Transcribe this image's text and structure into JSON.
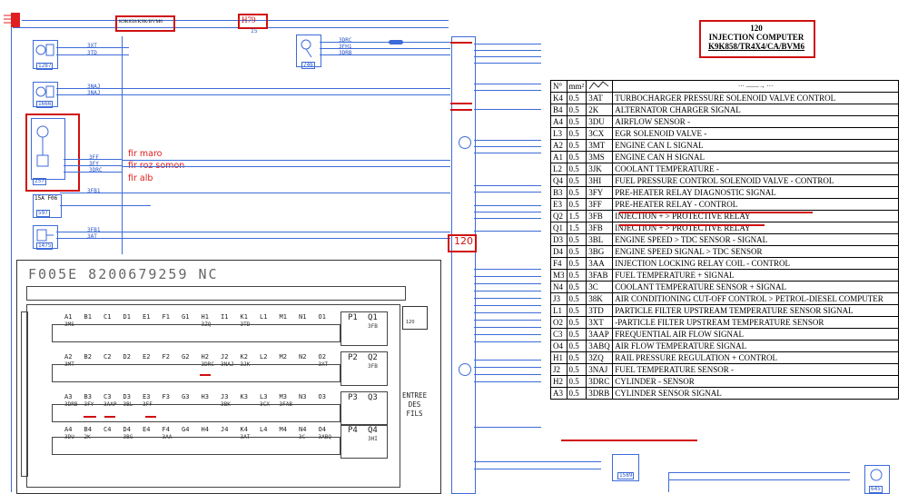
{
  "header": {
    "connector_code": "K9K858/K9K/BVM6",
    "h_code": "H79",
    "h_sub": "15"
  },
  "component": {
    "number": "120",
    "name": "INJECTION COMPUTER",
    "variant": "K9K858/TR4X4/CA/BVM6",
    "ecu_label": "120"
  },
  "annotations": {
    "fir_maro": "fir maro",
    "fir_roz": "fir roz somon",
    "fir_alb": "fir alb"
  },
  "left_components": [
    {
      "id": "1287",
      "wires": [
        "3XT",
        "3TD"
      ]
    },
    {
      "id": "1666",
      "wires": [
        "3NAJ",
        "3NAJ"
      ]
    },
    {
      "id": "257",
      "wires": [
        "3FF",
        "3FY",
        "3DRC"
      ]
    },
    {
      "id": "597",
      "wires": [
        "3FB1"
      ]
    },
    {
      "id": "1475",
      "wires": [
        "3FB1",
        "3AT"
      ]
    }
  ],
  "mid_component": {
    "id": "746",
    "wires": [
      "3DRC",
      "3FH1",
      "3DRB"
    ]
  },
  "bottom_component": {
    "id": "1589"
  },
  "right_component": {
    "id": "645"
  },
  "fuse_label": "15A F06",
  "connector_panel": {
    "ref": "F005E  8200679259  NC",
    "side_label_lines": [
      "ENTREE",
      "DES",
      "FILS"
    ],
    "icon_label": "120",
    "rows": [
      {
        "cells": [
          "A1",
          "B1",
          "C1",
          "D1",
          "E1",
          "F1",
          "G1",
          "H1",
          "I1",
          "K1",
          "L1",
          "M1",
          "N1",
          "O1"
        ],
        "codes": [
          "3MS",
          "",
          "",
          "",
          "",
          "",
          "",
          "3ZQ",
          "",
          "3TD",
          "",
          "",
          "",
          ""
        ]
      },
      {
        "cells": [
          "A2",
          "B2",
          "C2",
          "D2",
          "E2",
          "F2",
          "G2",
          "H2",
          "J2",
          "K2",
          "L2",
          "M2",
          "N2",
          "O2"
        ],
        "codes": [
          "3MT",
          "",
          "",
          "",
          "",
          "",
          "",
          "3DRC",
          "3NAJ",
          "3JK",
          "",
          "",
          "",
          "3XT"
        ]
      },
      {
        "cells": [
          "A3",
          "B3",
          "C3",
          "D3",
          "E3",
          "F3",
          "G3",
          "H3",
          "J3",
          "K3",
          "L3",
          "M3",
          "N3",
          "O3"
        ],
        "codes": [
          "3DRB",
          "3FY",
          "3AAP",
          "3BL",
          "3FF",
          "",
          "",
          "",
          "3BK",
          "",
          "3CX",
          "3FAB",
          "",
          ""
        ]
      },
      {
        "cells": [
          "A4",
          "B4",
          "C4",
          "D4",
          "E4",
          "F4",
          "G4",
          "H4",
          "J4",
          "K4",
          "L4",
          "M4",
          "N4",
          "O4"
        ],
        "codes": [
          "3DU",
          "2K",
          "",
          "3BG",
          "",
          "3AA",
          "",
          "",
          "",
          "3AT",
          "",
          "",
          "3C",
          "3ABQ"
        ]
      }
    ],
    "p_rows": [
      {
        "labels": [
          "P1",
          "Q1"
        ],
        "code": "3FB"
      },
      {
        "labels": [
          "P2",
          "Q2"
        ],
        "code": "3FB"
      },
      {
        "labels": [
          "P3",
          "Q3"
        ],
        "code": ""
      },
      {
        "labels": [
          "P4",
          "Q4"
        ],
        "code": "3HI"
      }
    ]
  },
  "table": {
    "headers": [
      "N°",
      "mm²",
      "",
      ""
    ],
    "arrow_header": "··· ——→ ···",
    "rows": [
      {
        "pin": "K4",
        "mm": "0.5",
        "code": "3AT",
        "desc": "TURBOCHARGER PRESSURE SOLENOID VALVE CONTROL"
      },
      {
        "pin": "B4",
        "mm": "0.5",
        "code": "2K",
        "desc": "ALTERNATOR CHARGER SIGNAL"
      },
      {
        "pin": "A4",
        "mm": "0.5",
        "code": "3DU",
        "desc": "AIRFLOW SENSOR -"
      },
      {
        "pin": "L3",
        "mm": "0.5",
        "code": "3CX",
        "desc": "EGR SOLENOID VALVE -"
      },
      {
        "pin": "A2",
        "mm": "0.5",
        "code": "3MT",
        "desc": "ENGINE CAN L SIGNAL"
      },
      {
        "pin": "A1",
        "mm": "0.5",
        "code": "3MS",
        "desc": "ENGINE CAN H SIGNAL"
      },
      {
        "pin": "L2",
        "mm": "0.5",
        "code": "3JK",
        "desc": "COOLANT TEMPERATURE -"
      },
      {
        "pin": "Q4",
        "mm": "0.5",
        "code": "3HI",
        "desc": "FUEL PRESSURE CONTROL SOLENOID VALVE - CONTROL"
      },
      {
        "pin": "B3",
        "mm": "0.5",
        "code": "3FY",
        "desc": "PRE-HEATER RELAY DIAGNOSTIC SIGNAL"
      },
      {
        "pin": "E3",
        "mm": "0.5",
        "code": "3FF",
        "desc": "PRE-HEATER RELAY - CONTROL"
      },
      {
        "pin": "Q2",
        "mm": "1.5",
        "code": "3FB",
        "desc": "INJECTION + > PROTECTIVE RELAY"
      },
      {
        "pin": "Q1",
        "mm": "1.5",
        "code": "3FB",
        "desc": "INJECTION + > PROTECTIVE RELAY"
      },
      {
        "pin": "D3",
        "mm": "0.5",
        "code": "3BL",
        "desc": "ENGINE SPEED > TDC SENSOR - SIGNAL"
      },
      {
        "pin": "D4",
        "mm": "0.5",
        "code": "3BG",
        "desc": "ENGINE SPEED SIGNAL > TDC SENSOR"
      },
      {
        "pin": "F4",
        "mm": "0.5",
        "code": "3AA",
        "desc": "INJECTION LOCKING RELAY COIL - CONTROL"
      },
      {
        "pin": "M3",
        "mm": "0.5",
        "code": "3FAB",
        "desc": "FUEL TEMPERATURE + SIGNAL"
      },
      {
        "pin": "N4",
        "mm": "0.5",
        "code": "3C",
        "desc": "COOLANT TEMPERATURE SENSOR + SIGNAL"
      },
      {
        "pin": "J3",
        "mm": "0.5",
        "code": "38K",
        "desc": "AIR CONDITIONING CUT-OFF CONTROL > PETROL-DIESEL COMPUTER"
      },
      {
        "pin": "L1",
        "mm": "0.5",
        "code": "3TD",
        "desc": "PARTICLE FILTER UPSTREAM TEMPERATURE SENSOR SIGNAL"
      },
      {
        "pin": "O2",
        "mm": "0.5",
        "code": "3XT",
        "desc": "-PARTICLE FILTER UPSTREAM TEMPERATURE SENSOR"
      },
      {
        "pin": "C3",
        "mm": "0.5",
        "code": "3AAP",
        "desc": "FREQUENTIAL AIR FLOW SIGNAL"
      },
      {
        "pin": "O4",
        "mm": "0.5",
        "code": "3ABQ",
        "desc": "AIR FLOW TEMPERATURE SIGNAL"
      },
      {
        "pin": "H1",
        "mm": "0.5",
        "code": "3ZQ",
        "desc": "RAIL PRESSURE REGULATION + CONTROL"
      },
      {
        "pin": "J2",
        "mm": "0.5",
        "code": "3NAJ",
        "desc": "FUEL TEMPERATURE SENSOR -"
      },
      {
        "pin": "H2",
        "mm": "0.5",
        "code": "3DRC",
        "desc": "CYLINDER - SENSOR"
      },
      {
        "pin": "A3",
        "mm": "0.5",
        "code": "3DRB",
        "desc": "CYLINDER SENSOR SIGNAL"
      }
    ]
  },
  "colors": {
    "wire": "#3d6bd8",
    "highlight": "#d01010"
  }
}
